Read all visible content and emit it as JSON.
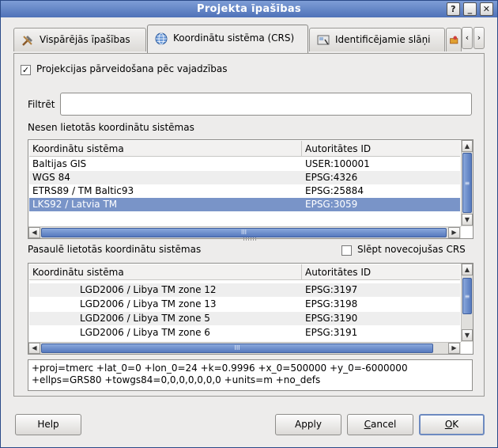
{
  "window": {
    "title": "Projekta īpašības"
  },
  "titlebar_buttons": [
    "?",
    "_",
    "✕"
  ],
  "tabs": [
    {
      "label": "Vispārējās īpašības",
      "icon": "hammer-icon"
    },
    {
      "label": "Koordinātu sistēma (CRS)",
      "icon": "globe-icon",
      "active": true
    },
    {
      "label": "Identificējamie slāņi",
      "icon": "identify-icon"
    }
  ],
  "tab_scroll": {
    "left": "‹",
    "right": "›"
  },
  "on_the_fly": {
    "label": "Projekcijas pārveidošana pēc vajadzības",
    "checked": true,
    "mark": "✓"
  },
  "filter": {
    "label": "Filtrēt",
    "value": ""
  },
  "recent": {
    "label": "Nesen lietotās koordinātu sistēmas",
    "columns": [
      "Koordinātu sistēma",
      "Autoritātes ID"
    ],
    "rows": [
      {
        "name": "Baltijas GIS",
        "id": "USER:100001"
      },
      {
        "name": "WGS 84",
        "id": "EPSG:4326"
      },
      {
        "name": "ETRS89 / TM Baltic93",
        "id": "EPSG:25884"
      },
      {
        "name": "LKS92 / Latvia TM",
        "id": "EPSG:3059",
        "selected": true
      }
    ]
  },
  "world": {
    "label": "Pasaulē lietotās koordinātu sistēmas",
    "hide_deprecated": {
      "label": "Slēpt novecojušas CRS",
      "checked": false
    },
    "columns": [
      "Koordinātu sistēma",
      "Autoritātes ID"
    ],
    "rows": [
      {
        "name": "LGD2006 / Libya TM zone 12",
        "id": "EPSG:3197"
      },
      {
        "name": "LGD2006 / Libya TM zone 13",
        "id": "EPSG:3198"
      },
      {
        "name": "LGD2006 / Libya TM zone 5",
        "id": "EPSG:3190"
      },
      {
        "name": "LGD2006 / Libya TM zone 6",
        "id": "EPSG:3191"
      }
    ]
  },
  "proj_string": {
    "line1": "+proj=tmerc +lat_0=0 +lon_0=24 +k=0.9996 +x_0=500000 +y_0=-6000000",
    "line2": "+ellps=GRS80 +towgs84=0,0,0,0,0,0,0 +units=m +no_defs"
  },
  "scroll_glyphs": {
    "up": "▲",
    "down": "▼",
    "left": "◀",
    "right": "▶",
    "grip_v": "≡",
    "grip_h": "III"
  },
  "buttons": {
    "help": "Help",
    "apply": "Apply",
    "cancel_first": "C",
    "cancel_rest": "ancel",
    "ok_first": "O",
    "ok_rest": "K"
  },
  "colors": {
    "selection": "#7994c8",
    "titlebar": "#5b7dc0",
    "scroll_thumb": "#5679bd"
  }
}
